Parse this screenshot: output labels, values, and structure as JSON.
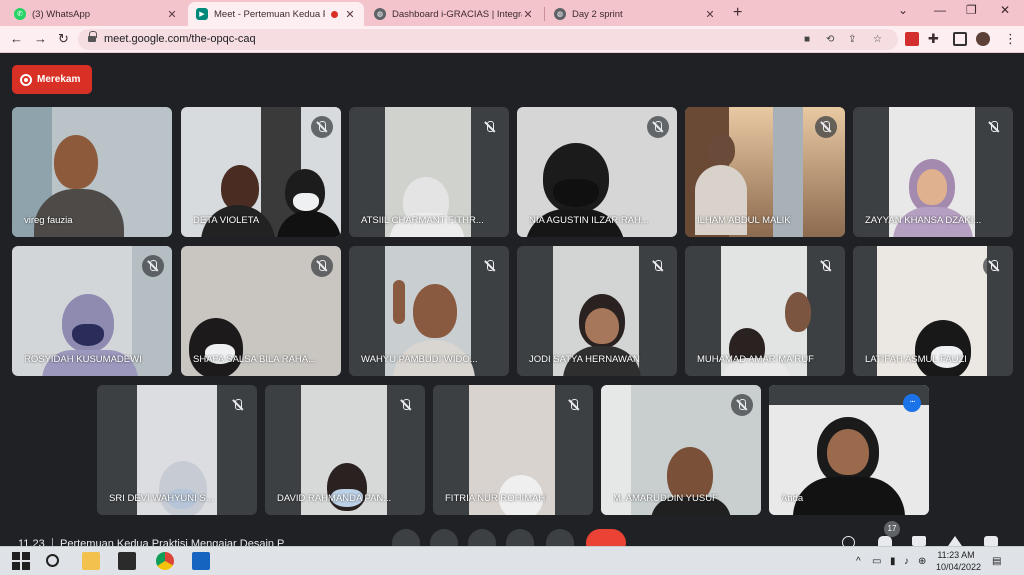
{
  "browser": {
    "tabs": [
      {
        "title": "(3) WhatsApp",
        "active": false,
        "favicon_color": "#25d366"
      },
      {
        "title": "Meet - Pertemuan Kedua P",
        "active": true,
        "favicon_color": "#00897b"
      },
      {
        "title": "Dashboard i-GRACIAS | Integrate",
        "active": false,
        "favicon_color": "#5f6368"
      },
      {
        "title": "Day 2 sprint",
        "active": false,
        "favicon_color": "#5f6368"
      }
    ],
    "url": "meet.google.com/the-opqc-caq"
  },
  "meet": {
    "record_label": "Merekam",
    "participants": [
      {
        "name": "vireg fauzia",
        "muted": false
      },
      {
        "name": "DETA VIOLETA",
        "muted": true
      },
      {
        "name": "ATSIIL CHARMANT FITHR...",
        "muted": true
      },
      {
        "name": "NIA AGUSTIN ILZAR RAH...",
        "muted": true
      },
      {
        "name": "ILHAM ABDUL MALIK",
        "muted": true
      },
      {
        "name": "ZAYYAN KHANSA DZAKI...",
        "muted": true
      },
      {
        "name": "ROSYIDAH KUSUMADEWI",
        "muted": true
      },
      {
        "name": "SHAFA SALSA BILA RAHA...",
        "muted": true
      },
      {
        "name": "WAHYU PAMBUDI WIDO...",
        "muted": true
      },
      {
        "name": "JODI SATYA HERNAWAN",
        "muted": true
      },
      {
        "name": "MUHAMAD AMAR MA'RUF",
        "muted": true
      },
      {
        "name": "LATIFAH ASMUL FAUZI",
        "muted": true
      },
      {
        "name": "SRI DEVI WAHYUNI S...",
        "muted": true
      },
      {
        "name": "DAVID RAHMANDA PAN...",
        "muted": true
      },
      {
        "name": "FITRIA NUR ROHIMAH",
        "muted": true
      },
      {
        "name": "M. AMARUDDIN YUSUF",
        "muted": true
      },
      {
        "name": "Anda",
        "muted": false,
        "self": true
      }
    ],
    "clock": "11.23",
    "meeting_name": "Pertemuan Kedua Praktisi Mengajar Desain P",
    "participant_count": "17",
    "more_icon": "..."
  },
  "taskbar": {
    "time": "11:23 AM",
    "date": "10/04/2022"
  },
  "colors": {
    "accent_red": "#d93025",
    "stage_bg": "#202124",
    "self_outline": "#8ab4f8"
  }
}
